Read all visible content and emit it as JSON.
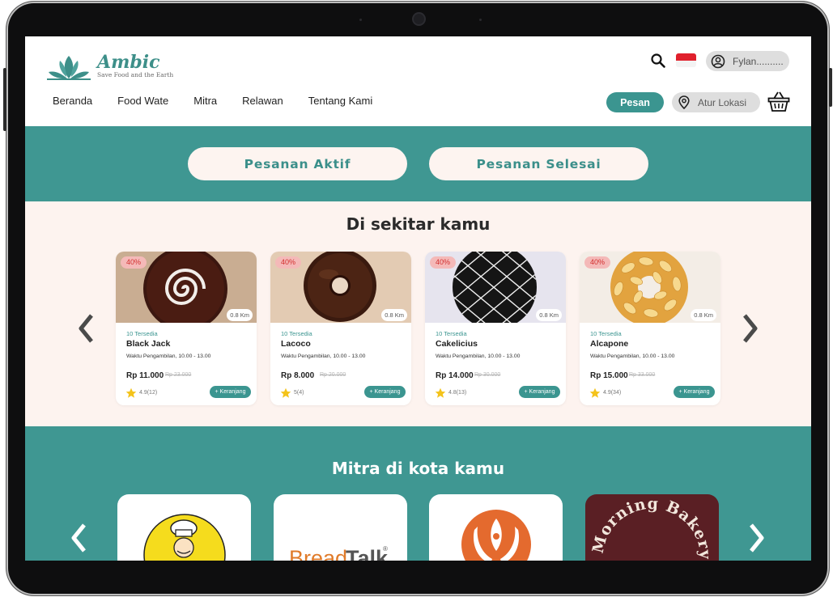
{
  "brand": {
    "name": "Ambic",
    "tagline": "Save Food and the Earth",
    "accent_color": "#3f9792",
    "logo_icon": "lotus-icon"
  },
  "header": {
    "nav": [
      "Beranda",
      "Food Wate",
      "Mitra",
      "Relawan",
      "Tentang Kami"
    ],
    "user_name": "Fylan..........",
    "order_button": "Pesan",
    "location_button": "Atur Lokasi",
    "icons": [
      "search-icon",
      "indonesia-flag-icon",
      "user-circle-icon",
      "location-pin-icon",
      "basket-icon"
    ]
  },
  "order_tabs": {
    "active": "Pesanan Aktif",
    "done": "Pesanan Selesai"
  },
  "nearby": {
    "title": "Di sekitar kamu",
    "products": [
      {
        "name": "Black Jack",
        "discount": "40%",
        "distance": "0.8 Km",
        "available": "10 Tersedia",
        "pickup": "Waktu Pengambilan, 10.00 - 13.00",
        "price": "Rp 11.000",
        "old_price": "Rp 23.000",
        "rating": "4.9(12)",
        "cart_label": "+ Keranjang",
        "image": "chocolate-swirl-donut"
      },
      {
        "name": "Lacoco",
        "discount": "40%",
        "distance": "0.8 Km",
        "available": "10 Tersedia",
        "pickup": "Waktu Pengambilan, 10.00 - 13.00",
        "price": "Rp 8.000",
        "old_price": "Rp 20.000",
        "rating": "5(4)",
        "cart_label": "+ Keranjang",
        "image": "chocolate-glazed-donut"
      },
      {
        "name": "Cakelicius",
        "discount": "40%",
        "distance": "0.8 Km",
        "available": "10 Tersedia",
        "pickup": "Waktu Pengambilan, 10.00 - 13.00",
        "price": "Rp 14.000",
        "old_price": "Rp 30.000",
        "rating": "4.8(13)",
        "cart_label": "+ Keranjang",
        "image": "black-grid-cake"
      },
      {
        "name": "Alcapone",
        "discount": "40%",
        "distance": "0.8 Km",
        "available": "10 Tersedia",
        "pickup": "Waktu Pengambilan, 10.00 - 13.00",
        "price": "Rp 15.000",
        "old_price": "Rp 33.000",
        "rating": "4.9(34)",
        "cart_label": "+ Keranjang",
        "image": "almond-donut"
      }
    ]
  },
  "partners": {
    "title": "Mitra di kota kamu",
    "items": [
      {
        "name": "chef-logo-partner",
        "bg": "#ffffff"
      },
      {
        "name": "BreadTalk",
        "bg": "#ffffff"
      },
      {
        "name": "orange-emblem-partner",
        "bg": "#ffffff"
      },
      {
        "name": "Morning Bakery",
        "bg": "#5a1f24"
      }
    ],
    "breadtalk_text": {
      "bread": "Bread",
      "talk": "Talk",
      "reg": "®"
    },
    "morning_bakery_text": "Morning Bakery"
  }
}
